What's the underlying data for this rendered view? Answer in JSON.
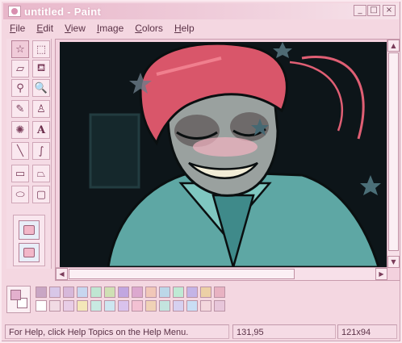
{
  "window": {
    "title": "untitled - Paint",
    "controls": {
      "minimize": "_",
      "maximize": "□",
      "close": "×"
    }
  },
  "menu": [
    "File",
    "Edit",
    "View",
    "Image",
    "Colors",
    "Help"
  ],
  "tools": [
    {
      "name": "free-form-select",
      "glyph": "☆"
    },
    {
      "name": "rect-select",
      "glyph": "⬚"
    },
    {
      "name": "eraser",
      "glyph": "▱"
    },
    {
      "name": "fill",
      "glyph": "⛾"
    },
    {
      "name": "pick-color",
      "glyph": "⚲"
    },
    {
      "name": "magnifier",
      "glyph": "🔍"
    },
    {
      "name": "pencil",
      "glyph": "✎"
    },
    {
      "name": "brush",
      "glyph": "♙"
    },
    {
      "name": "airbrush",
      "glyph": "✺"
    },
    {
      "name": "text",
      "glyph": "A"
    },
    {
      "name": "line",
      "glyph": "╲"
    },
    {
      "name": "curve",
      "glyph": "∫"
    },
    {
      "name": "rectangle",
      "glyph": "▭"
    },
    {
      "name": "polygon",
      "glyph": "⏢"
    },
    {
      "name": "ellipse",
      "glyph": "⬭"
    },
    {
      "name": "rounded-rect",
      "glyph": "▢"
    }
  ],
  "palette": {
    "foreground": "#e3b0ce",
    "background": "#ffffff",
    "colors_row1": [
      "#c9a6c4",
      "#d8c7e8",
      "#d7b8da",
      "#c7d6ef",
      "#bfe6d2",
      "#cfe0b4",
      "#c1a6e0",
      "#dca8cf",
      "#f1c7b8",
      "#bcd7e8",
      "#bfe9d4",
      "#c4b4e6",
      "#ecd0a6",
      "#e8b2c2"
    ],
    "colors_row2": [
      "#ffffff",
      "#f1dbe4",
      "#e8cde6",
      "#f3e7b8",
      "#c8eae2",
      "#cde6f0",
      "#d9c2ec",
      "#f3c1d3",
      "#f0d2b6",
      "#c3e4de",
      "#d6d0f0",
      "#c9def4",
      "#f4d8dd",
      "#e7c6da"
    ]
  },
  "status": {
    "help_text": "For Help, click Help Topics on the Help Menu.",
    "cursor_pos": "131,95",
    "size": "121x94"
  }
}
